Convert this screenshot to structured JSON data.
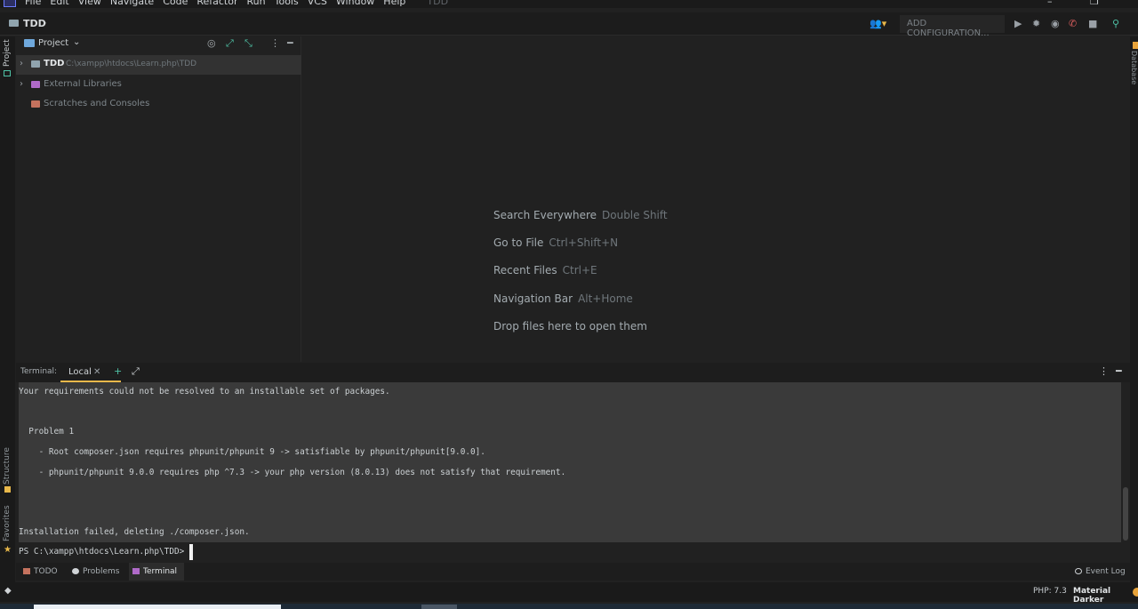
{
  "menu": {
    "items": [
      "File",
      "Edit",
      "View",
      "Navigate",
      "Code",
      "Refactor",
      "Run",
      "Tools",
      "VCS",
      "Window",
      "Help"
    ],
    "project_title": "TDD"
  },
  "navbar": {
    "breadcrumb": "TDD",
    "config_button": "ADD CONFIGURATION..."
  },
  "left_strip": {
    "project": "Project",
    "structure": "Structure",
    "favorites": "Favorites"
  },
  "right_strip": {
    "database": "Database"
  },
  "project_panel": {
    "title": "Project",
    "tree": [
      {
        "label": "TDD",
        "path": "C:\\xampp\\htdocs\\Learn.php\\TDD"
      },
      {
        "label": "External Libraries"
      },
      {
        "label": "Scratches and Consoles"
      }
    ]
  },
  "editor": {
    "hints": [
      {
        "action": "Search Everywhere",
        "shortcut": "Double Shift"
      },
      {
        "action": "Go to File",
        "shortcut": "Ctrl+Shift+N"
      },
      {
        "action": "Recent Files",
        "shortcut": "Ctrl+E"
      },
      {
        "action": "Navigation Bar",
        "shortcut": "Alt+Home"
      },
      {
        "action": "Drop files here to open them",
        "shortcut": ""
      }
    ]
  },
  "terminal": {
    "label": "Terminal:",
    "tab": "Local",
    "lines": [
      "Your requirements could not be resolved to an installable set of packages.",
      "  Problem 1",
      "    - Root composer.json requires phpunit/phpunit 9 -> satisfiable by phpunit/phpunit[9.0.0].",
      "    - phpunit/phpunit 9.0.0 requires php ^7.3 -> your php version (8.0.13) does not satisfy that requirement.",
      "Installation failed, deleting ./composer.json."
    ],
    "prompt": "PS C:\\xampp\\htdocs\\Learn.php\\TDD>"
  },
  "bottom_tools": {
    "todo": "TODO",
    "problems": "Problems",
    "terminal": "Terminal",
    "event_log": "Event Log"
  },
  "status": {
    "php": "PHP: 7.3",
    "theme": "Material Darker"
  }
}
